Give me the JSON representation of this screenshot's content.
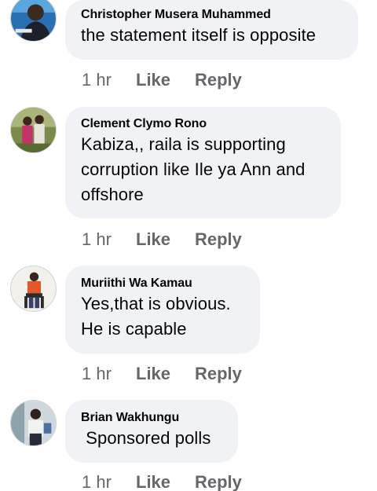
{
  "comments": [
    {
      "author": "Christopher Musera Muhammed",
      "text_lines": [
        "the statement itself is opposite"
      ],
      "time": "1 hr",
      "like_label": "Like",
      "reply_label": "Reply"
    },
    {
      "author": "Clement Clymo Rono",
      "text_lines": [
        "Kabiza,, raila  is supporting",
        "corruption like Ile ya Ann and",
        "offshore"
      ],
      "time": "1 hr",
      "like_label": "Like",
      "reply_label": "Reply"
    },
    {
      "author": "Muriithi Wa Kamau",
      "text_lines": [
        "Yes,that is obvious.",
        "He is capable"
      ],
      "time": "1 hr",
      "like_label": "Like",
      "reply_label": "Reply"
    },
    {
      "author": "Brian Wakhungu",
      "text_lines": [
        " Sponsored polls"
      ],
      "time": "1 hr",
      "like_label": "Like",
      "reply_label": "Reply"
    }
  ],
  "colors": {
    "bubble": "#f0f2f5",
    "meta_text": "#65676b",
    "name_text": "#050505"
  }
}
